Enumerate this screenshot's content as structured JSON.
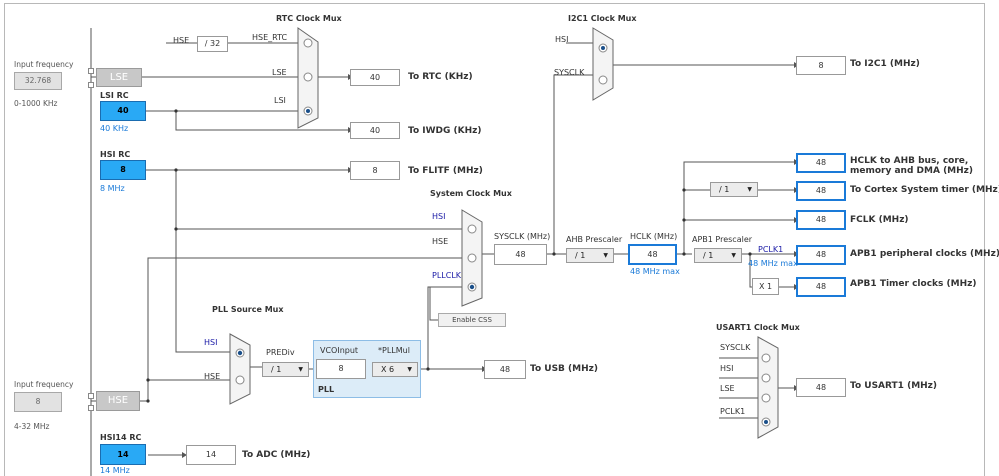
{
  "titles": {
    "rtc_mux": "RTC Clock Mux",
    "i2c1_mux": "I2C1 Clock Mux",
    "sys_mux": "System Clock Mux",
    "pll_source_mux": "PLL Source Mux",
    "usart1_mux": "USART1 Clock Mux"
  },
  "left": {
    "input_freq_label": "Input frequency",
    "lse_input": "32.768",
    "lse_range": "0-1000 KHz",
    "lse_box": "LSE",
    "lsi_label": "LSI RC",
    "lsi_value": "40",
    "lsi_sub": "40 KHz",
    "hsi_label": "HSI RC",
    "hsi_value": "8",
    "hsi_sub": "8 MHz",
    "hse_input_label": "Input frequency",
    "hse_input": "8",
    "hse_range": "4-32 MHz",
    "hse_box": "HSE",
    "hsi14_label": "HSI14 RC",
    "hsi14_value": "14",
    "hsi14_sub": "14 MHz"
  },
  "rtc": {
    "hse_label": "HSE",
    "div32": "/ 32",
    "hse_rtc": "HSE_RTC",
    "lse": "LSE",
    "lsi": "LSI",
    "rtc_value": "40",
    "rtc_out": "To RTC (KHz)",
    "iwdg_value": "40",
    "iwdg_out": "To IWDG (KHz)",
    "flitf_value": "8",
    "flitf_out": "To FLITF (MHz)"
  },
  "i2c": {
    "hsi": "HSI",
    "sysclk": "SYSCLK",
    "value": "8",
    "out": "To I2C1 (MHz)"
  },
  "sys": {
    "hsi": "HSI",
    "hse": "HSE",
    "pllclk": "PLLCLK",
    "sysclk_label": "SYSCLK (MHz)",
    "sysclk_value": "48",
    "enable_css": "Enable CSS",
    "ahb_label": "AHB Prescaler",
    "ahb_value": "/ 1",
    "hclk_label": "HCLK (MHz)",
    "hclk_value": "48",
    "hclk_max": "48 MHz max",
    "apb1_label": "APB1 Prescaler",
    "apb1_value": "/ 1",
    "pclk1": "PCLK1",
    "pclk1_max": "48 MHz max",
    "x1": "X 1",
    "cortex_div": "/ 1"
  },
  "outputs": [
    {
      "value": "48",
      "label": "HCLK to AHB bus, core,"
    },
    {
      "value": "48",
      "label": "To Cortex System timer (MHz)"
    },
    {
      "value": "48",
      "label": "FCLK (MHz)"
    },
    {
      "value": "48",
      "label": "APB1 peripheral clocks (MHz)"
    },
    {
      "value": "48",
      "label": "APB1 Timer clocks (MHz)"
    }
  ],
  "outputs_line2": "memory and DMA (MHz)",
  "pll": {
    "hsi": "HSI",
    "hse": "HSE",
    "prediv_label": "PREDiv",
    "prediv_value": "/ 1",
    "vco_label": "VCOInput",
    "vco_value": "8",
    "pllmul_label": "*PLLMul",
    "pllmul_value": "X 6",
    "pll_label": "PLL",
    "usb_value": "48",
    "usb_out": "To USB (MHz)"
  },
  "usart": {
    "sysclk": "SYSCLK",
    "hsi": "HSI",
    "lse": "LSE",
    "pclk1": "PCLK1",
    "value": "48",
    "out": "To USART1 (MHz)"
  },
  "adc": {
    "value": "14",
    "out": "To ADC (MHz)"
  }
}
